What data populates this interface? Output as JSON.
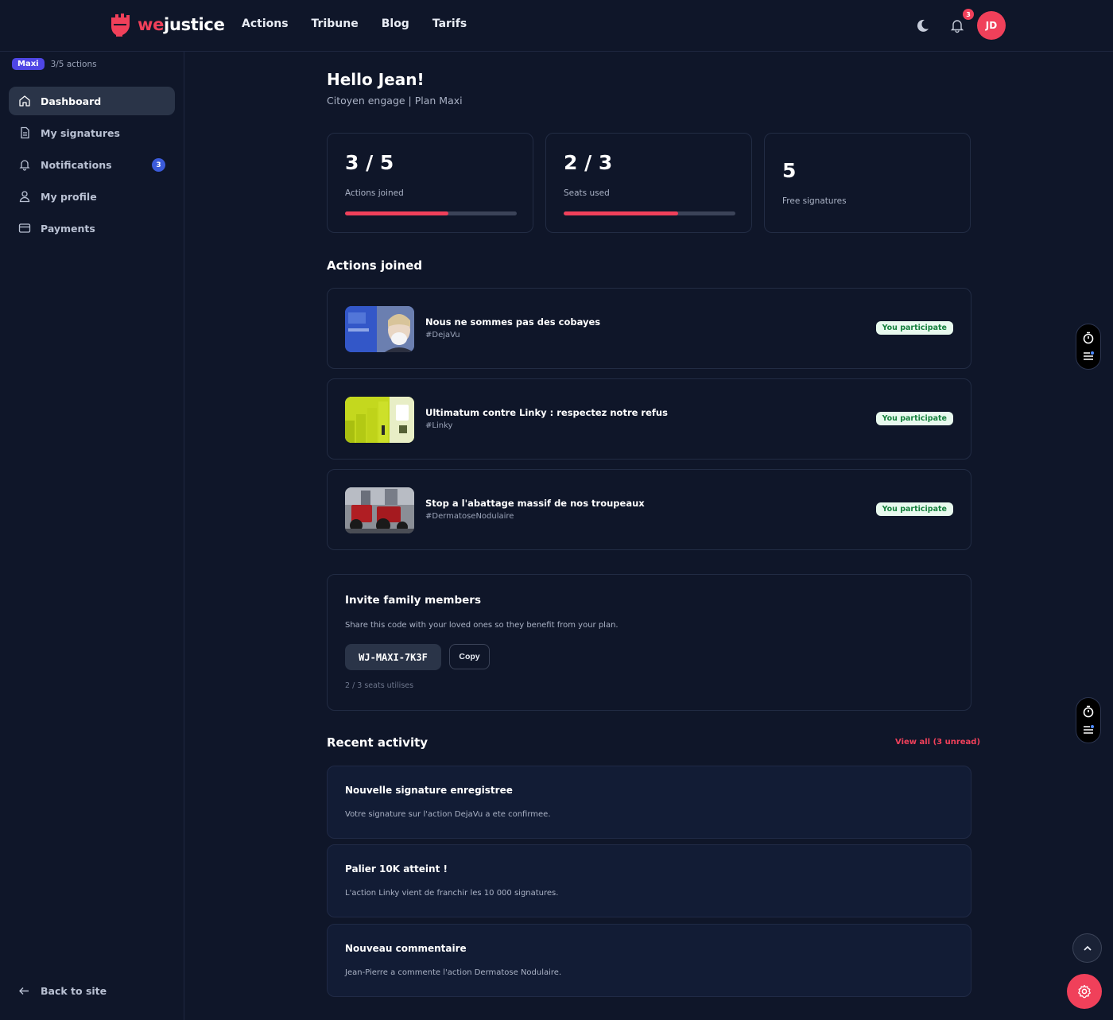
{
  "brand": {
    "we": "we",
    "justice": "justice",
    "color": "#f0405a"
  },
  "nav": [
    {
      "label": "Actions"
    },
    {
      "label": "Tribune"
    },
    {
      "label": "Blog"
    },
    {
      "label": "Tarifs"
    }
  ],
  "header": {
    "notification_count": "3",
    "avatar_initials": "JD"
  },
  "sidebar": {
    "plan_badge": "Maxi",
    "plan_count": "3/5 actions",
    "items": [
      {
        "label": "Dashboard",
        "icon": "home-icon",
        "active": true
      },
      {
        "label": "My signatures",
        "icon": "document-icon"
      },
      {
        "label": "Notifications",
        "icon": "bell-icon",
        "badge": "3"
      },
      {
        "label": "My profile",
        "icon": "user-icon"
      },
      {
        "label": "Payments",
        "icon": "card-icon"
      }
    ],
    "back_label": "Back to site"
  },
  "main": {
    "greeting": "Hello Jean!",
    "subtitle": "Citoyen engage | Plan Maxi",
    "stats": [
      {
        "value": "3 / 5",
        "label": "Actions joined",
        "progress": 0.6
      },
      {
        "value": "2 / 3",
        "label": "Seats used",
        "progress": 0.667
      },
      {
        "value": "5",
        "label": "Free signatures"
      }
    ],
    "actions_title": "Actions joined",
    "actions": [
      {
        "title": "Nous ne sommes pas des cobayes",
        "tag": "#DejaVu",
        "status": "You participate"
      },
      {
        "title": "Ultimatum contre Linky : respectez notre refus",
        "tag": "#Linky",
        "status": "You participate"
      },
      {
        "title": "Stop a l'abattage massif de nos troupeaux",
        "tag": "#DermatoseNodulaire",
        "status": "You participate"
      }
    ],
    "invite": {
      "title": "Invite family members",
      "description": "Share this code with your loved ones so they benefit from your plan.",
      "code": "WJ-MAXI-7K3F",
      "copy_label": "Copy",
      "seats_note": "2 / 3 seats utilises"
    },
    "activity_title": "Recent activity",
    "view_all": "View all (3 unread)",
    "activity": [
      {
        "title": "Nouvelle signature enregistree",
        "description": "Votre signature sur l'action DejaVu a ete confirmee."
      },
      {
        "title": "Palier 10K atteint !",
        "description": "L'action Linky vient de franchir les 10 000 signatures."
      },
      {
        "title": "Nouveau commentaire",
        "description": "Jean-Pierre a commente l'action Dermatose Nodulaire."
      }
    ]
  }
}
